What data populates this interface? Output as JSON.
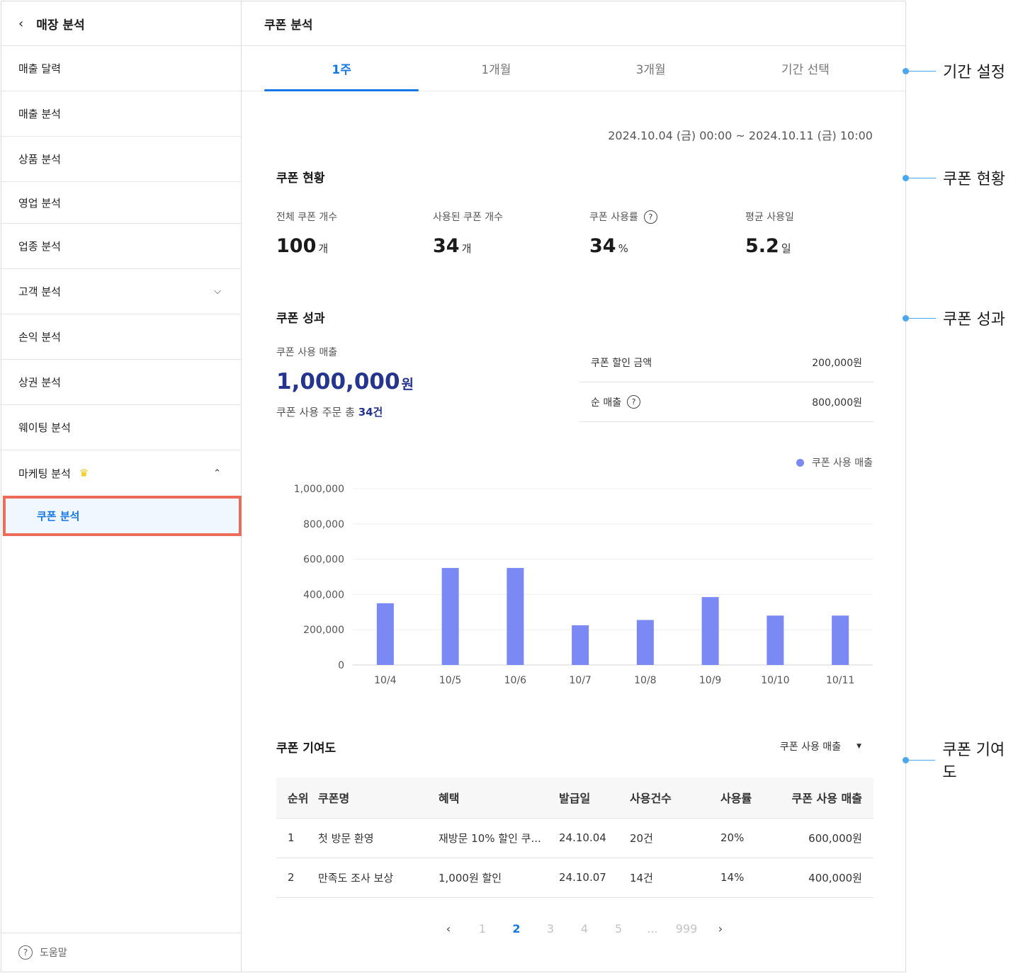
{
  "sidebar": {
    "back_icon": "chevron-left-icon",
    "title": "매장 분석",
    "items": [
      {
        "label": "매출 달력"
      },
      {
        "label": "매출 분석"
      },
      {
        "label": "상품 분석"
      },
      {
        "label": "영업 분석"
      },
      {
        "label": "업종 분석"
      },
      {
        "label": "고객 분석"
      },
      {
        "label": "손익 분석"
      },
      {
        "label": "상권 분석"
      },
      {
        "label": "웨이팅 분석"
      },
      {
        "label": "마케팅 분석"
      }
    ],
    "sub_item": "쿠폰 분석",
    "help": "도움말"
  },
  "main": {
    "title": "쿠폰 분석",
    "tabs": [
      "1주",
      "1개월",
      "3개월",
      "기간 선택"
    ],
    "active_tab": "1주",
    "date_range": "2024.10.04 (금) 00:00 ~ 2024.10.11 (금) 10:00"
  },
  "status": {
    "title": "쿠폰 현황",
    "items": [
      {
        "label": "전체 쿠폰 개수",
        "value": "100",
        "unit": "개"
      },
      {
        "label": "사용된 쿠폰 개수",
        "value": "34",
        "unit": "개"
      },
      {
        "label": "쿠폰 사용률",
        "value": "34",
        "unit": "%"
      },
      {
        "label": "평균 사용일",
        "value": "5.2",
        "unit": "일"
      }
    ]
  },
  "performance": {
    "title": "쿠폰 성과",
    "sales_label": "쿠폰 사용 매출",
    "sales_value": "1,000,000",
    "sales_unit": "원",
    "orders_prefix": "쿠폰 사용 주문 총",
    "orders_value": "34건",
    "discount_label": "쿠폰 할인 금액",
    "discount_value": "200,000원",
    "net_label": "순 매출",
    "net_value": "800,000원"
  },
  "chart_data": {
    "type": "bar",
    "categories": [
      "10/4",
      "10/5",
      "10/6",
      "10/7",
      "10/8",
      "10/9",
      "10/10",
      "10/11"
    ],
    "series": [
      {
        "name": "쿠폰 사용 매출",
        "values": [
          350000,
          550000,
          550000,
          225000,
          255000,
          385000,
          280000,
          280000
        ],
        "color": "#7b89f4"
      }
    ],
    "y_ticks": [
      "0",
      "200,000",
      "400,000",
      "600,000",
      "800,000",
      "1,000,000"
    ],
    "ylim": [
      0,
      1000000
    ],
    "grid": true,
    "legend": "top-right"
  },
  "contribution": {
    "title": "쿠폰 기여도",
    "select_value": "쿠폰 사용 매출",
    "columns": [
      "순위",
      "쿠폰명",
      "혜택",
      "발급일",
      "사용건수",
      "사용률",
      "쿠폰 사용 매출"
    ],
    "rows": [
      [
        "1",
        "첫 방문 환영",
        "재방문 10% 할인 쿠...",
        "24.10.04",
        "20건",
        "20%",
        "600,000원"
      ],
      [
        "2",
        "만족도 조사 보상",
        "1,000원 할인",
        "24.10.07",
        "14건",
        "14%",
        "400,000원"
      ]
    ]
  },
  "pagination": {
    "pages": [
      "1",
      "2",
      "3",
      "4",
      "5",
      "...",
      "999"
    ],
    "current": "2"
  },
  "annotations": [
    "기간 설정",
    "쿠폰 현황",
    "쿠폰 성과",
    "쿠폰 기여도"
  ],
  "colors": {
    "accent": "#1677e6",
    "navy": "#24348f",
    "bar": "#7b89f4",
    "highlight_border": "#ec6b5a",
    "annotation": "#4aa6ee"
  }
}
